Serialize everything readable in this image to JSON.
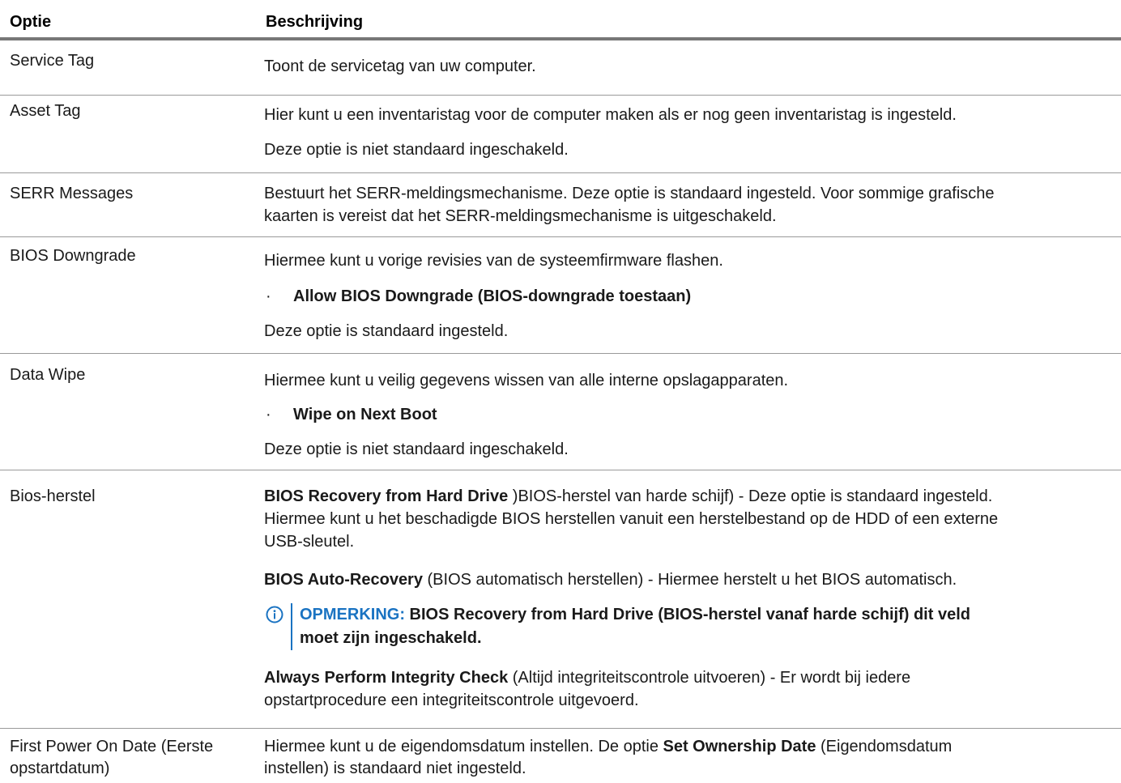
{
  "header": {
    "option": "Optie",
    "description": "Beschrijving"
  },
  "rows": [
    {
      "option": "Service Tag",
      "desc": "Toont de servicetag van uw computer."
    },
    {
      "option": "Asset Tag",
      "p1": "Hier kunt u een inventaristag voor de computer maken als er nog geen inventaristag is ingesteld.",
      "p2": "Deze optie is niet standaard ingeschakeld."
    },
    {
      "option": "SERR Messages",
      "p1_line1": "Bestuurt het SERR-meldingsmechanisme. Deze optie is standaard ingesteld. Voor sommige grafische",
      "p1_line2": "kaarten is vereist dat het SERR-meldingsmechanisme is uitgeschakeld."
    },
    {
      "option": "BIOS Downgrade",
      "p1": "Hiermee kunt u vorige revisies van de systeemfirmware flashen.",
      "bullet": "Allow BIOS Downgrade (BIOS-downgrade toestaan)",
      "p2": "Deze optie is standaard ingesteld."
    },
    {
      "option": "Data Wipe",
      "p1": "Hiermee kunt u veilig gegevens wissen van alle interne opslagapparaten.",
      "bullet": "Wipe on Next Boot",
      "p2": "Deze optie is niet standaard ingeschakeld."
    },
    {
      "option": "Bios-herstel",
      "p1_bold": "BIOS Recovery from Hard Drive",
      "p1_rest_line1": " )BIOS-herstel van harde schijf) - Deze optie is standaard ingesteld.",
      "p1_line2": "Hiermee kunt u het beschadigde BIOS herstellen vanuit een herstelbestand op de HDD of een externe",
      "p1_line3": "USB-sleutel.",
      "p2_bold": "BIOS Auto-Recovery",
      "p2_rest": " (BIOS automatisch herstellen) - Hiermee herstelt u het BIOS automatisch.",
      "note_label": "OPMERKING:",
      "note_line1": " BIOS Recovery from Hard Drive (BIOS-herstel vanaf harde schijf) dit veld",
      "note_line2": "moet zijn ingeschakeld.",
      "p3_bold": "Always Perform Integrity Check",
      "p3_rest_line1": " (Altijd integriteitscontrole uitvoeren) - Er wordt bij iedere",
      "p3_line2": "opstartprocedure een integriteitscontrole uitgevoerd."
    },
    {
      "option_line1": "First Power On Date (Eerste",
      "option_line2": "opstartdatum)",
      "p1_pre": "Hiermee kunt u de eigendomsdatum instellen. De optie ",
      "p1_bold": "Set Ownership Date",
      "p1_post": " (Eigendomsdatum",
      "p1_line2": "instellen) is standaard niet ingesteld."
    }
  ],
  "icons": {
    "note": "info-circle-icon"
  },
  "colors": {
    "accent": "#1a73c2",
    "header_rule": "#777777",
    "row_rule": "#9a9a9a"
  }
}
